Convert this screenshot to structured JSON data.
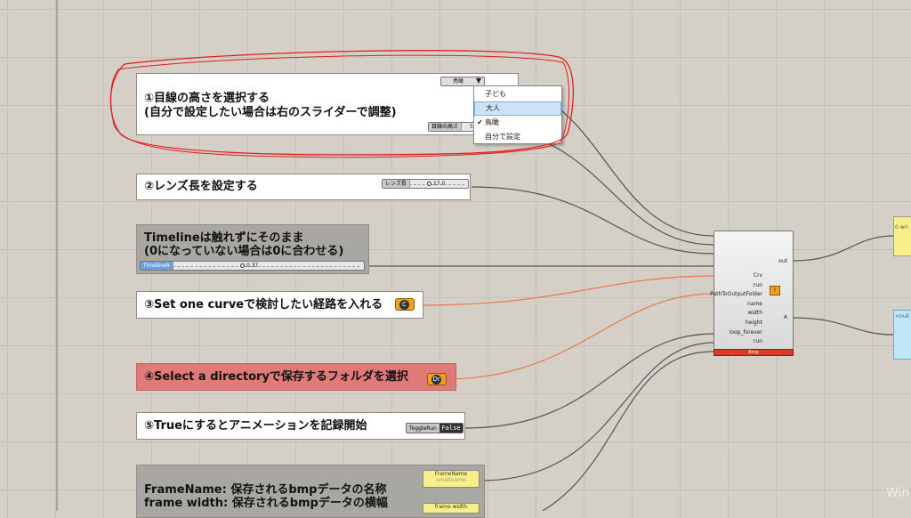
{
  "panels": {
    "eye_height": {
      "line1": "①目線の高さを選択する",
      "line2": "(自分で設定したい場合は右のスライダーで調整)"
    },
    "lens": {
      "line1": "②レンズ長を設定する"
    },
    "timeline": {
      "line1": "Timelineは触れずにそのまま",
      "line2": "(0になっていない場合は0に合わせる)"
    },
    "curve": {
      "line1": "③Set one curveで検討したい経路を入れる"
    },
    "directory": {
      "line1": "④Select a directoryで保存するフォルダを選択"
    },
    "record": {
      "line1": "⑤Trueにするとアニメーションを記録開始"
    },
    "frame_info": {
      "line1": "FrameName: 保存されるbmpデータの名称",
      "line2": "frame width: 保存されるbmpデータの横幅"
    }
  },
  "eye_dropdown": {
    "selected": "鳥瞰",
    "options": [
      "子ども",
      "大人",
      "鳥瞰",
      "自分で設定"
    ],
    "highlighted": "大人",
    "checked": "鳥瞰"
  },
  "eye_slider": {
    "label": "目線の高さ",
    "value": "5"
  },
  "lens_slider": {
    "label": "レンズ長",
    "value": "17.0"
  },
  "timeline_slider": {
    "label": "TimelineA",
    "value": "0.37"
  },
  "toggle": {
    "label": "ToggleRun",
    "value": "False"
  },
  "curve_param": {
    "symbol": "C"
  },
  "directory_param": {
    "symbol": "Dr"
  },
  "main_component": {
    "inputs": [
      "Crv",
      "run",
      "PathToOutputFolder",
      "name",
      "width",
      "height",
      "loop_forever",
      "run"
    ],
    "outputs": [
      "out",
      "A"
    ],
    "footer": "Bmp"
  },
  "yellow_nodes": [
    {
      "label": "FrameName",
      "value": "smallname"
    },
    {
      "label": "frame width",
      "value": ""
    }
  ],
  "side_nodes": {
    "yellow_text": "0 wri",
    "blue_text": "<null"
  },
  "watermark": "Win",
  "colors": {
    "highlight_circle": "#e02020",
    "wire_grey": "#555555",
    "wire_orange": "#e8784a"
  }
}
